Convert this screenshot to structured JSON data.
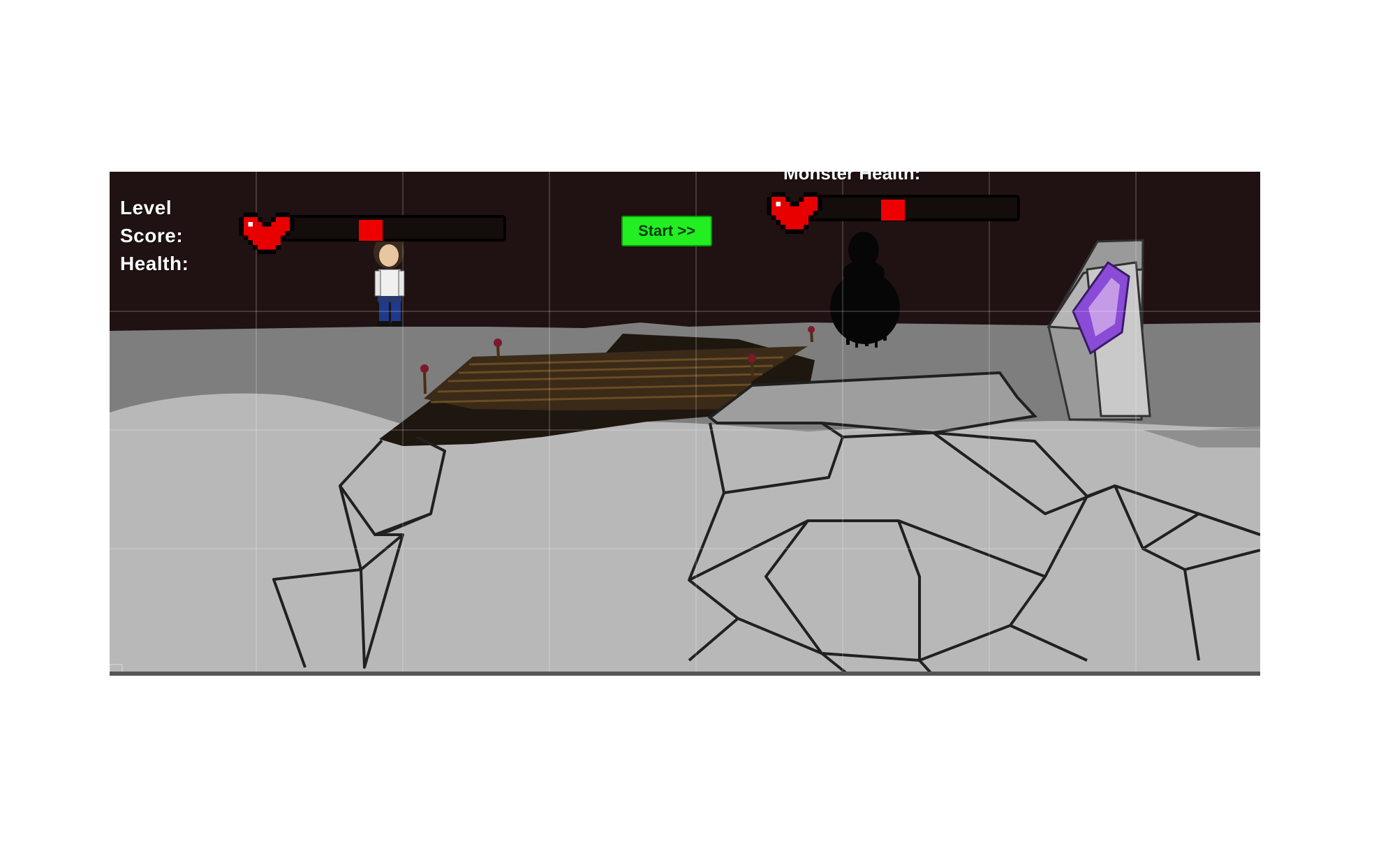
{
  "hud": {
    "level_label": "Level",
    "score_label": "Score:",
    "health_label": "Health:",
    "player_health_fraction": 0.4,
    "monster_title": "Monster Health:",
    "monster_health_fraction": 0.4
  },
  "start_button": {
    "label": "Start >>"
  },
  "icons": {
    "player_health": "heart-icon",
    "monster_health": "heart-icon"
  },
  "colors": {
    "sky": "#201212",
    "ground_dark": "#7e7e7e",
    "ground_light": "#b8b8b8",
    "bridge": "#3b2a18",
    "portal": "#8a4bd6",
    "health_fill": "#ee0000",
    "start_button": "#22ee22"
  }
}
